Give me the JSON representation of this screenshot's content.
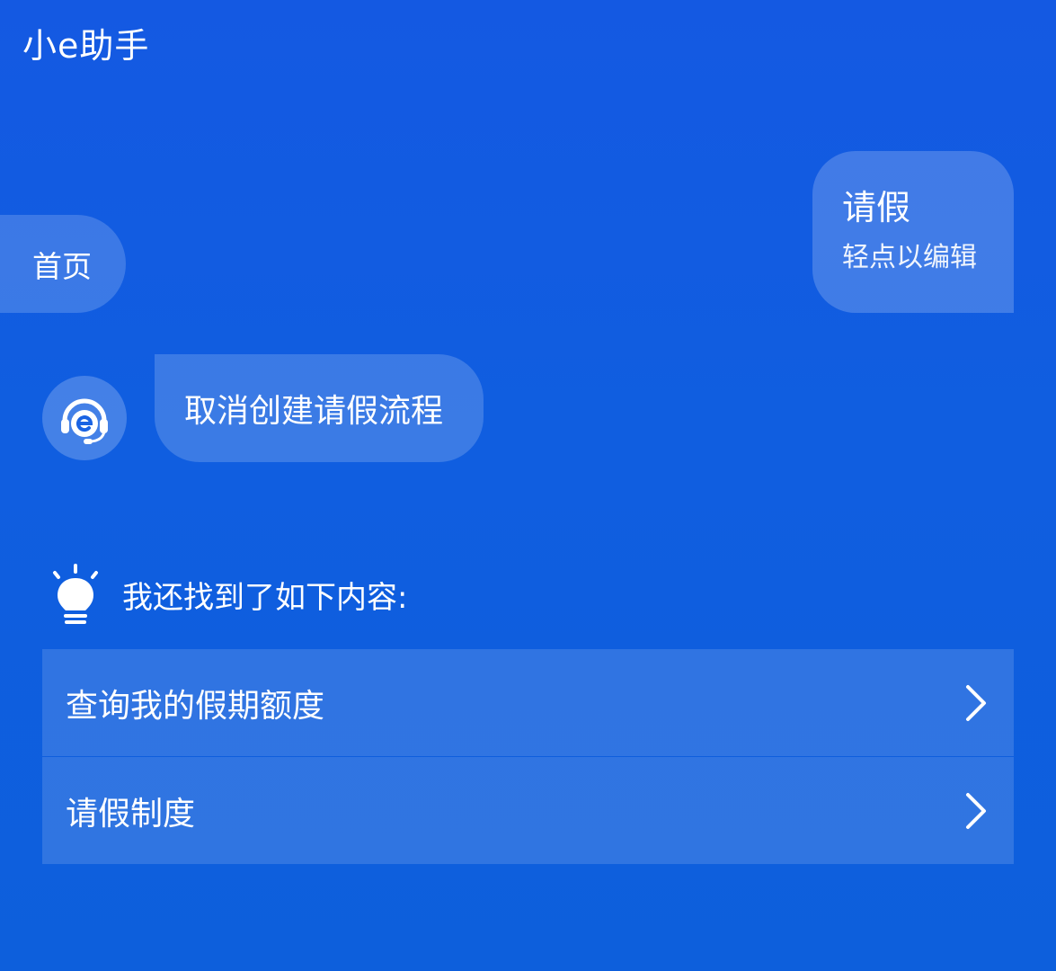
{
  "header": {
    "title": "小e助手"
  },
  "nav": {
    "home_label": "首页"
  },
  "user_message": {
    "text": "请假",
    "hint": "轻点以编辑"
  },
  "bot_message": {
    "text": "取消创建请假流程",
    "avatar_icon": "headset-e-icon"
  },
  "suggestions": {
    "header": "我还找到了如下内容:",
    "header_icon": "lightbulb-icon",
    "items": [
      {
        "label": "查询我的假期额度",
        "icon": "chevron-right-icon"
      },
      {
        "label": "请假制度",
        "icon": "chevron-right-icon"
      }
    ]
  },
  "colors": {
    "background": "#1059E0",
    "text": "#FFFFFF"
  }
}
